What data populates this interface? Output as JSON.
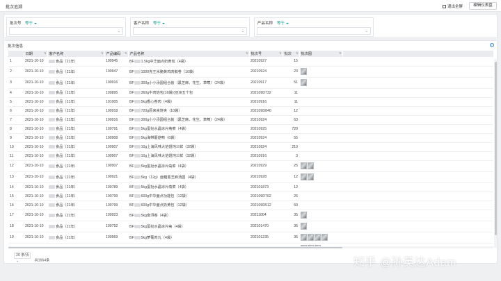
{
  "header": {
    "title": "批次追溯",
    "exit_label": "退出全屏",
    "edit_label": "编辑仪表盘"
  },
  "filters": [
    {
      "label": "批次号",
      "operator": "等于",
      "value": ""
    },
    {
      "label": "客户名称",
      "operator": "等于",
      "value": ""
    },
    {
      "label": "产品名称",
      "operator": "等于",
      "value": ""
    }
  ],
  "detail": {
    "title": "批次信息",
    "info_icon": "info-icon"
  },
  "table": {
    "columns": [
      "",
      "日期",
      "客户名称",
      "产品编码",
      "产品名称",
      "批次号",
      "批次",
      "批次图"
    ],
    "rows": [
      {
        "n": "1",
        "date": "2021-10-10",
        "cust": "食品（21年）",
        "code": "100945",
        "pre": "BF",
        "name": "1.5kg中华面点奶黄包（4袋）",
        "batch": "20210927",
        "qty": "15",
        "imgs": 0
      },
      {
        "n": "2",
        "date": "2021-10-10",
        "cust": "食品（21年）",
        "code": "100947",
        "pre": "BF",
        "name": "1000克王米脆黄鸡肉鹅卷（10袋）",
        "batch": "20210924",
        "qty": "23",
        "imgs": 1
      },
      {
        "n": "3",
        "date": "2021-10-10",
        "cust": "食品（21年）",
        "code": "100916",
        "pre": "BF",
        "name": "300g小小汤圆组合装（黑芝麻、花生、草莓）（24袋）",
        "batch": "20210917",
        "qty": "51",
        "imgs": 1
      },
      {
        "n": "4",
        "date": "2021-10-10",
        "cust": "食品（21年）",
        "code": "100895",
        "pre": "BF",
        "name": "360g牛肉馅包(16袋)(亚洲五个包",
        "batch": "202109D732",
        "qty": "11",
        "imgs": 0
      },
      {
        "n": "5",
        "date": "2021-10-10",
        "cust": "食品（21年）",
        "code": "101005",
        "pre": "BF",
        "name": "5kg香心卷肉（4袋）",
        "batch": "20210916",
        "qty": "11",
        "imgs": 0
      },
      {
        "n": "6",
        "date": "2021-10-10",
        "cust": "食品（21年）",
        "code": "100918",
        "pre": "BF",
        "name": "720g原来来饼夹（10袋）",
        "batch": "202109D840",
        "qty": "12",
        "imgs": 0
      },
      {
        "n": "7",
        "date": "2021-10-10",
        "cust": "食品（21年）",
        "code": "100916",
        "pre": "BF",
        "name": "300g小小汤圆组合装（黑芝麻、花生、草莓）（24袋）",
        "batch": "20210924",
        "qty": "63",
        "imgs": 0
      },
      {
        "n": "8",
        "date": "2021-10-10",
        "cust": "食品（21年）",
        "code": "100791",
        "pre": "BF",
        "name": "5kg蛋挞水晶凉片斋菜（4袋）",
        "batch": "20210925",
        "qty": "720",
        "imgs": 0
      },
      {
        "n": "9",
        "date": "2021-10-10",
        "cust": "食品（21年）",
        "code": "100908",
        "pre": "BF",
        "name": "5kg海带蘑菇鸭（6袋）",
        "batch": "20210924",
        "qty": "55",
        "imgs": 0
      },
      {
        "n": "10",
        "date": "2021-10-10",
        "cust": "食品（21年）",
        "code": "100907",
        "pre": "BF",
        "name": "10g上海风味大馅馄饨三鲜（32袋）",
        "batch": "20210924",
        "qty": "210",
        "imgs": 0
      },
      {
        "n": "11",
        "date": "2021-10-10",
        "cust": "食品（21年）",
        "code": "100907",
        "pre": "BF",
        "name": "10g上海风味大馅馄饨三鲜（32袋）",
        "batch": "20210916",
        "qty": "3",
        "imgs": 0
      },
      {
        "n": "12",
        "date": "2021-10-10",
        "cust": "食品（21年）",
        "code": "100907",
        "pre": "BF",
        "name": "5kg蛋挞水晶凉片斋菜（4袋）",
        "batch": "20210929",
        "qty": "25",
        "imgs": 2
      },
      {
        "n": "13",
        "date": "2021-10-10",
        "cust": "食品（21年）",
        "code": "100921",
        "pre": "BF",
        "name": "5kg（12g）面糖黑芝麻汤圆（4袋）",
        "batch": "20210928",
        "qty": "12",
        "imgs": 2
      },
      {
        "n": "14",
        "date": "2021-10-10",
        "cust": "食品（21年）",
        "code": "100789",
        "pre": "BF",
        "name": "5kg蛋挞水晶凉片斋菜（4袋）",
        "batch": "202101873",
        "qty": "12",
        "imgs": 0
      },
      {
        "n": "15",
        "date": "2021-10-10",
        "cust": "食品（21年）",
        "code": "100799",
        "pre": "BF",
        "name": "600g中华面点功能包（12袋）",
        "batch": "202109D702",
        "qty": "26",
        "imgs": 0
      },
      {
        "n": "16",
        "date": "2021-10-10",
        "cust": "食品（21年）",
        "code": "100799",
        "pre": "BF",
        "name": "600g中华面点奶黄包（12袋）",
        "batch": "202109D512",
        "qty": "60",
        "imgs": 0
      },
      {
        "n": "17",
        "date": "2021-10-10",
        "cust": "食品（21年）",
        "code": "100923",
        "pre": "BF",
        "name": "5kg南浔卷（4袋）",
        "batch": "20211004",
        "qty": "35",
        "imgs": 1
      },
      {
        "n": "18",
        "date": "2021-10-10",
        "cust": "食品（21年）",
        "code": "100792",
        "pre": "BF",
        "name": "5kg蛋挞水晶凉片斋（4袋）",
        "batch": "202101470",
        "qty": "36",
        "imgs": 1
      },
      {
        "n": "19",
        "date": "2021-10-10",
        "cust": "食品（21年）",
        "code": "100969",
        "pre": "BF",
        "name": "5kg萝葡肉丸（4袋）",
        "batch": "202101235",
        "qty": "36",
        "imgs": 4
      },
      {
        "n": "20",
        "date": "2021-10-10",
        "cust": "食品（21年）",
        "code": "100922",
        "pre": "BF",
        "name": "5kg上海风味大馅馄饨（4袋）",
        "batch": "20210904",
        "qty": "23",
        "imgs": 3
      }
    ]
  },
  "footer": {
    "page_size": "20 条/页",
    "total": "共1664条"
  },
  "watermark": "知乎 @孙英达Adam"
}
